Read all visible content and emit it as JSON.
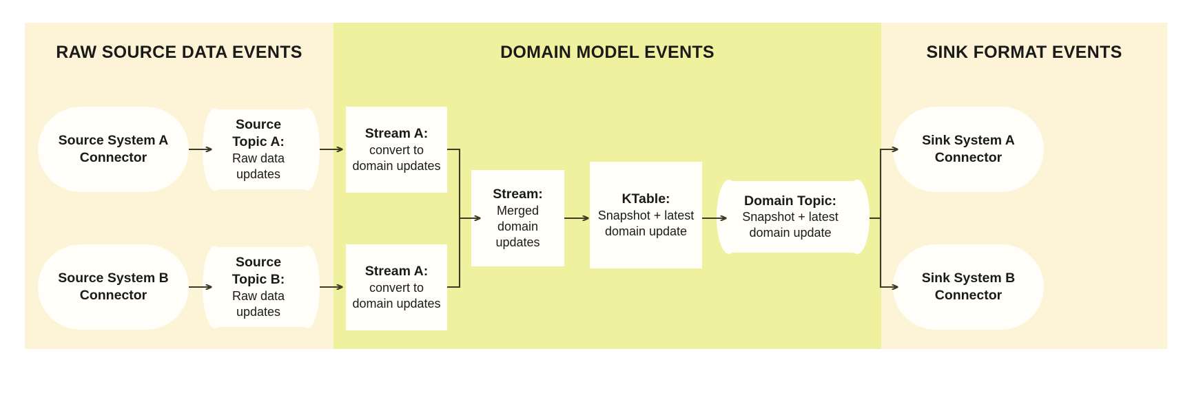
{
  "figure": {
    "kind": "streaming-data-pipeline-diagram"
  },
  "panels": [
    {
      "id": "raw",
      "title": "RAW SOURCE DATA EVENTS",
      "color": "#fdf3d7"
    },
    {
      "id": "domain",
      "title": "DOMAIN MODEL EVENTS",
      "color": "#eff19f"
    },
    {
      "id": "sink",
      "title": "SINK FORMAT\nEVENTS",
      "color": "#fdf3d7"
    }
  ],
  "nodes": {
    "source_connector_a": {
      "title": "Source System A\nConnector",
      "subtitle": "",
      "shape": "pill"
    },
    "source_connector_b": {
      "title": "Source System B\nConnector",
      "subtitle": "",
      "shape": "pill"
    },
    "source_topic_a": {
      "title": "Source\nTopic A:",
      "subtitle": "Raw data\nupdates",
      "shape": "cylinder"
    },
    "source_topic_b": {
      "title": "Source\nTopic B:",
      "subtitle": "Raw data\nupdates",
      "shape": "cylinder"
    },
    "stream_a_top": {
      "title": "Stream A:",
      "subtitle": "convert to\ndomain updates",
      "shape": "rect"
    },
    "stream_a_bottom": {
      "title": "Stream A:",
      "subtitle": "convert to\ndomain updates",
      "shape": "rect"
    },
    "stream_merged": {
      "title": "Stream:",
      "subtitle": "Merged\ndomain\nupdates",
      "shape": "rect"
    },
    "ktable": {
      "title": "KTable:",
      "subtitle": "Snapshot + latest\ndomain update",
      "shape": "rect"
    },
    "domain_topic": {
      "title": "Domain Topic:",
      "subtitle": "Snapshot + latest\ndomain update",
      "shape": "cylinder"
    },
    "sink_connector_a": {
      "title": "Sink System A\nConnector",
      "subtitle": "",
      "shape": "pill"
    },
    "sink_connector_b": {
      "title": "Sink System B\nConnector",
      "subtitle": "",
      "shape": "pill"
    }
  },
  "colors": {
    "panel_raw": "#fdf3d7",
    "panel_domain": "#eff19f",
    "node_fill": "#fffef9",
    "text": "#1a1a18",
    "arrow": "#3d3a24"
  },
  "flows": [
    {
      "from": "source_connector_a",
      "to": "source_topic_a"
    },
    {
      "from": "source_topic_a",
      "to": "stream_a_top"
    },
    {
      "from": "source_connector_b",
      "to": "source_topic_b"
    },
    {
      "from": "source_topic_b",
      "to": "stream_a_bottom"
    },
    {
      "from": "stream_a_top",
      "to": "stream_merged"
    },
    {
      "from": "stream_a_bottom",
      "to": "stream_merged"
    },
    {
      "from": "stream_merged",
      "to": "ktable"
    },
    {
      "from": "ktable",
      "to": "domain_topic"
    },
    {
      "from": "domain_topic",
      "to": "sink_connector_a"
    },
    {
      "from": "domain_topic",
      "to": "sink_connector_b"
    }
  ]
}
